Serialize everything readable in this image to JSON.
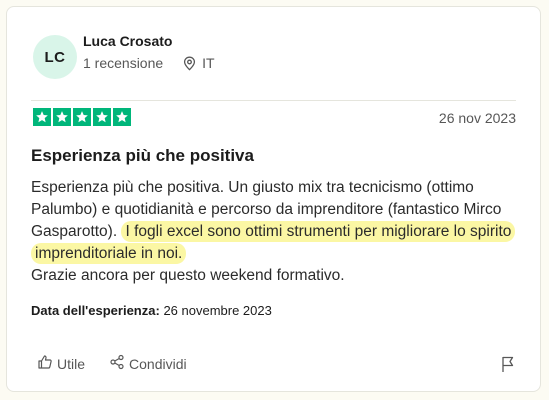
{
  "reviewer": {
    "initials": "LC",
    "name": "Luca Crosato",
    "review_count": "1 recensione",
    "country": "IT"
  },
  "review": {
    "rating": 5,
    "date": "26 nov 2023",
    "title": "Esperienza più che positiva",
    "body_part1": "Esperienza più che positiva. Un giusto mix tra tecnicismo (ottimo Palumbo) e quotidianità e percorso da imprenditore (fantastico Mirco Gasparotto).",
    "body_highlight": "I fogli excel sono ottimi strumenti per migliorare lo spirito imprenditoriale in noi.",
    "body_part2": "Grazie ancora per questo weekend formativo.",
    "experience_label": "Data dell'esperienza:",
    "experience_date": "26 novembre 2023"
  },
  "actions": {
    "useful_label": "Utile",
    "share_label": "Condividi"
  },
  "colors": {
    "star_green": "#00b67a",
    "avatar_bg": "#d9f5e9",
    "highlight": "#fbf7a4"
  }
}
